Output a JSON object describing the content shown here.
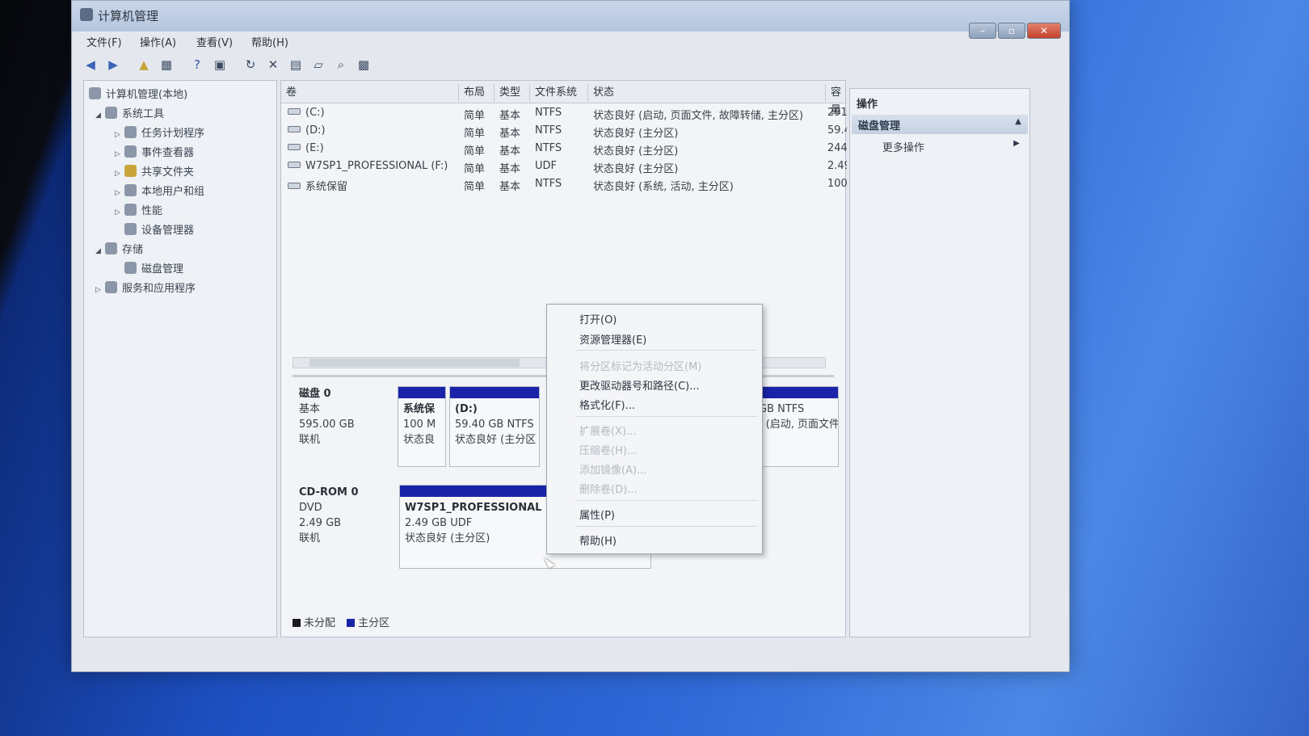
{
  "window": {
    "title": "计算机管理"
  },
  "menu": [
    "文件(F)",
    "操作(A)",
    "查看(V)",
    "帮助(H)"
  ],
  "toolbar": {
    "icons": [
      "back-arrow-icon",
      "forward-arrow-icon",
      "up-folder-icon",
      "console-tree-icon",
      "help-icon",
      "show-hide-icon",
      "refresh-icon",
      "delete-icon",
      "properties-icon",
      "open-icon",
      "search-icon",
      "disk-icon"
    ]
  },
  "tree": {
    "root": "计算机管理(本地)",
    "system_tools": "系统工具",
    "task_scheduler": "任务计划程序",
    "event_viewer": "事件查看器",
    "shared_folders": "共享文件夹",
    "local_users": "本地用户和组",
    "performance": "性能",
    "device_manager": "设备管理器",
    "storage": "存储",
    "disk_management": "磁盘管理",
    "services": "服务和应用程序"
  },
  "columns": [
    "卷",
    "布局",
    "类型",
    "文件系统",
    "状态",
    "容量"
  ],
  "volumes": [
    {
      "name": "(C:)",
      "layout": "简单",
      "type": "基本",
      "fs": "NTFS",
      "status": "状态良好 (启动, 页面文件, 故障转储, 主分区)",
      "capacity": "291."
    },
    {
      "name": "(D:)",
      "layout": "简单",
      "type": "基本",
      "fs": "NTFS",
      "status": "状态良好 (主分区)",
      "capacity": "59.4("
    },
    {
      "name": "(E:)",
      "layout": "简单",
      "type": "基本",
      "fs": "NTFS",
      "status": "状态良好 (主分区)",
      "capacity": "244."
    },
    {
      "name": "W7SP1_PROFESSIONAL (F:)",
      "layout": "简单",
      "type": "基本",
      "fs": "UDF",
      "status": "状态良好 (主分区)",
      "capacity": "2.49"
    },
    {
      "name": "系统保留",
      "layout": "简单",
      "type": "基本",
      "fs": "NTFS",
      "status": "状态良好 (系统, 活动, 主分区)",
      "capacity": "100 I"
    }
  ],
  "disk0": {
    "name": "磁盘 0",
    "kind": "基本",
    "size": "595.00 GB",
    "state": "联机",
    "parts": [
      {
        "name": "系统保",
        "line2": "100 M",
        "line3": "状态良"
      },
      {
        "name": "(D:)",
        "line2": "59.40 GB NTFS",
        "line3": "状态良好 (主分区"
      },
      {
        "name": "",
        "line2": "GB NTFS",
        "line3": "f (启动, 页面文件"
      }
    ]
  },
  "cdrom0": {
    "name": "CD-ROM 0",
    "kind": "DVD",
    "size": "2.49 GB",
    "state": "联机",
    "part": {
      "name": "W7SP1_PROFESSIONAL",
      "line2": "2.49 GB UDF",
      "line3": "状态良好 (主分区)"
    }
  },
  "legend": [
    {
      "label": "未分配",
      "color": "#1b1b1b"
    },
    {
      "label": "主分区",
      "color": "#1a23a8"
    }
  ],
  "actions": {
    "title": "操作",
    "section": "磁盘管理",
    "more": "更多操作"
  },
  "context_menu": {
    "open": "打开(O)",
    "explore": "资源管理器(E)",
    "mark_active": "将分区标记为活动分区(M)",
    "change_letter": "更改驱动器号和路径(C)...",
    "format": "格式化(F)...",
    "extend": "扩展卷(X)...",
    "shrink": "压缩卷(H)...",
    "add_mirror": "添加镜像(A)...",
    "delete": "删除卷(D)...",
    "properties": "属性(P)",
    "help": "帮助(H)"
  },
  "colors": {
    "primary_partition": "#1a23a8",
    "desktop": "#2f6ad8"
  }
}
